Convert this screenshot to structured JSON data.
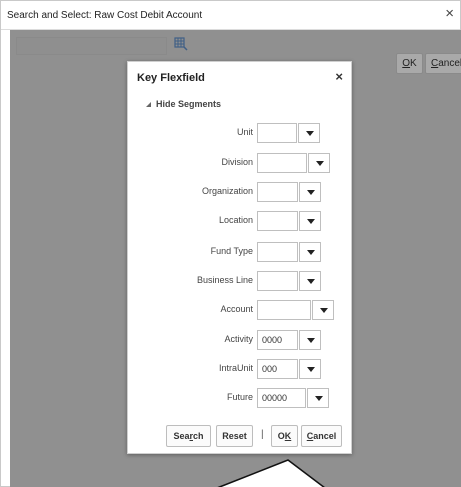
{
  "window": {
    "title": "Search and Select: Raw Cost Debit Account",
    "close_glyph": "×"
  },
  "background": {
    "ok_label": "OK",
    "cancel_label": "Cancel",
    "search_icon": "search-icon"
  },
  "dialog": {
    "title": "Key Flexfield",
    "close_glyph": "×",
    "hide_segments_label": "Hide Segments",
    "segments": [
      {
        "label": "Unit",
        "value": ""
      },
      {
        "label": "Division",
        "value": ""
      },
      {
        "label": "Organization",
        "value": ""
      },
      {
        "label": "Location",
        "value": ""
      },
      {
        "label": "Fund Type",
        "value": ""
      },
      {
        "label": "Business Line",
        "value": ""
      },
      {
        "label": "Account",
        "value": ""
      },
      {
        "label": "Activity",
        "value": "0000"
      },
      {
        "label": "IntraUnit",
        "value": "000"
      },
      {
        "label": "Future",
        "value": "00000"
      }
    ],
    "buttons": {
      "search": "Search",
      "reset": "Reset",
      "separator": "|",
      "ok": "OK",
      "cancel": "Cancel"
    }
  },
  "colors": {
    "overlay": "#909090",
    "dialog_bg": "#ffffff",
    "border": "#bfbfbf"
  }
}
